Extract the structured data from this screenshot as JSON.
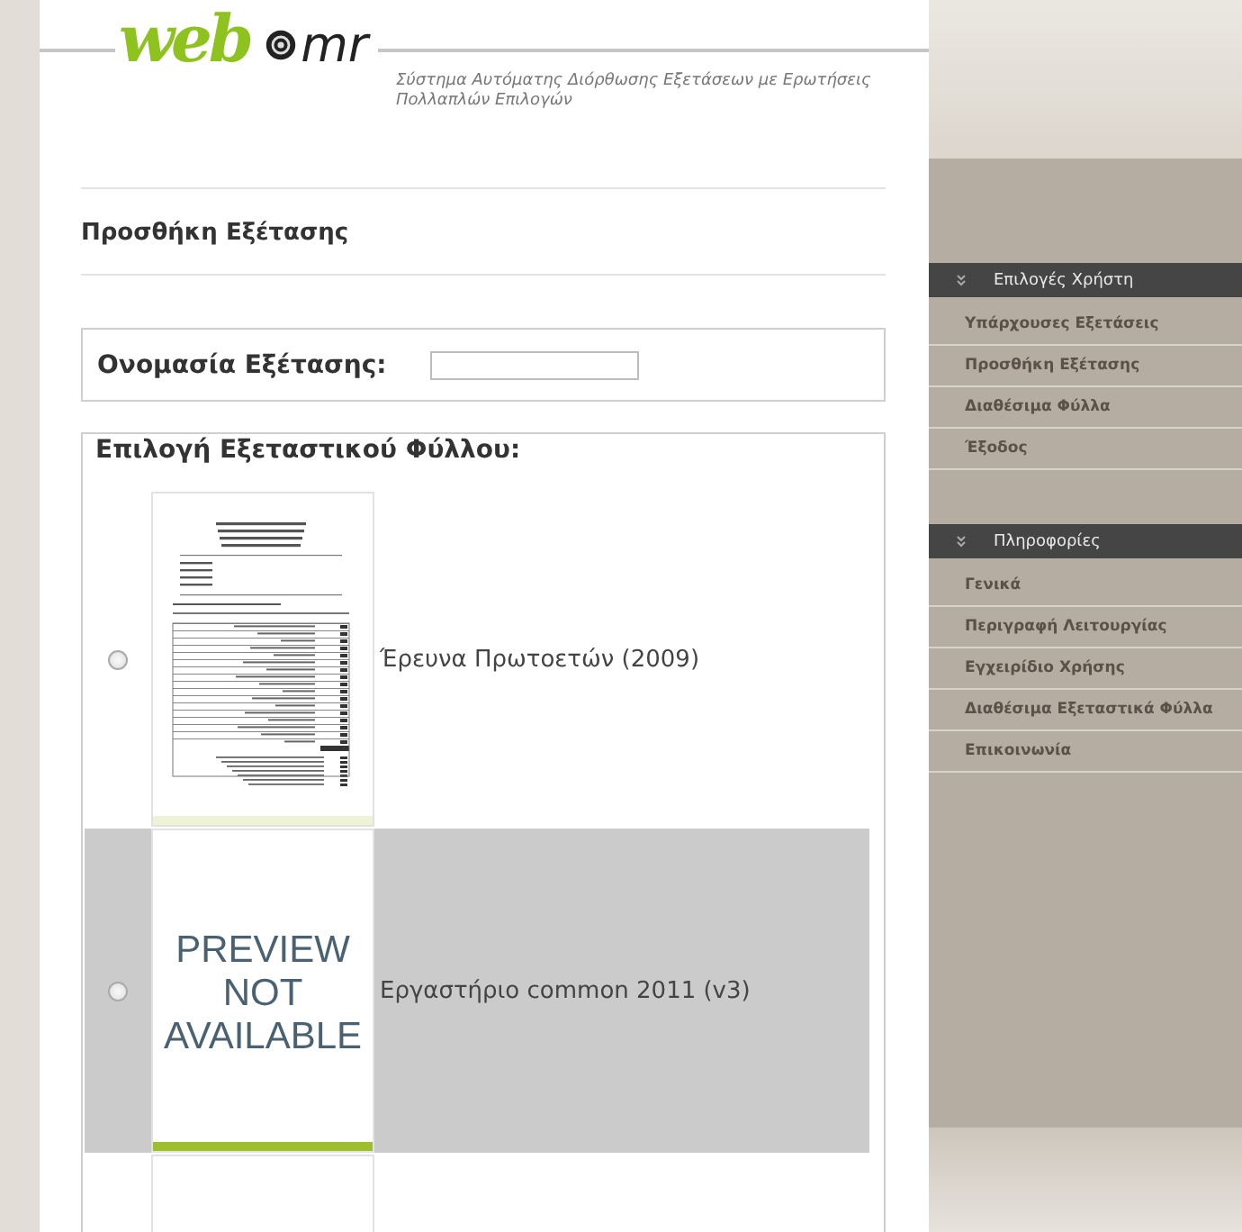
{
  "header": {
    "logo": {
      "part_1": "web",
      "part_2": "mr"
    },
    "subtitle": "Σύστημα Αυτόματης Διόρθωσης Εξετάσεων με Ερωτήσεις Πολλαπλών Επιλογών"
  },
  "page_title": "Προσθήκη Εξέτασης",
  "exam_name": {
    "label": "Ονομασία Εξέτασης:"
  },
  "sheet_picker": {
    "label": "Επιλογή Εξεταστικού Φύλλου:",
    "rows": [
      {
        "kind": "sheet",
        "thumbnail": {
          "kind": "document"
        },
        "label": "Έρευνα Πρωτοετών (2009)",
        "selected": false,
        "highlighted": false
      },
      {
        "kind": "sheet",
        "thumbnail": {
          "kind": "unavailable",
          "text": [
            "PREVIEW",
            "NOT",
            "AVAILABLE"
          ]
        },
        "label": "Εργαστήριο common 2011 (v3)",
        "selected": false,
        "highlighted": true
      },
      {
        "kind": "partial",
        "thumbnail": {
          "kind": "blank"
        }
      }
    ]
  },
  "sidebar": {
    "sections": [
      {
        "title": "Επιλογές Χρήστη",
        "items": [
          "Υπάρχουσες Εξετάσεις",
          "Προσθήκη Εξέτασης",
          "Διαθέσιμα Φύλλα",
          "Έξοδος"
        ]
      },
      {
        "title": "Πληροφορίες",
        "items": [
          "Γενικά",
          "Περιγραφή Λειτουργίας",
          "Εγχειρίδιο Χρήσης",
          "Διαθέσιμα Εξεταστικά Φύλλα",
          "Επικοινωνία"
        ]
      }
    ]
  }
}
